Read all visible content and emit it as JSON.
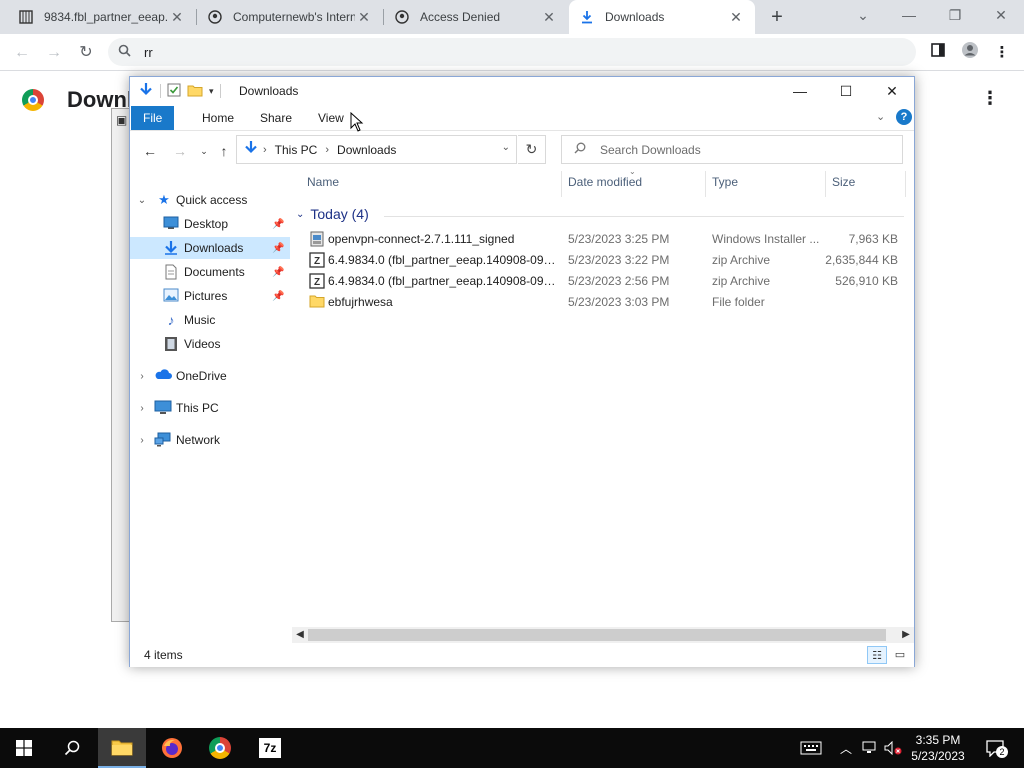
{
  "chrome": {
    "tabs": [
      {
        "title": "9834.fbl_partner_eeap...",
        "icon": "archive-icon"
      },
      {
        "title": "Computernewb's Intern...",
        "icon": "user-icon"
      },
      {
        "title": "Access Denied",
        "icon": "user-icon"
      },
      {
        "title": "Downloads",
        "icon": "download-icon"
      }
    ],
    "omnibox_text": "rr",
    "page_title": "Downlo"
  },
  "explorer": {
    "title": "Downloads",
    "ribbon_tabs": [
      "File",
      "Home",
      "Share",
      "View"
    ],
    "breadcrumb": [
      "This PC",
      "Downloads"
    ],
    "search_placeholder": "Search Downloads",
    "nav": {
      "quick_access": "Quick access",
      "items": [
        "Desktop",
        "Downloads",
        "Documents",
        "Pictures",
        "Music",
        "Videos"
      ],
      "onedrive": "OneDrive",
      "this_pc": "This PC",
      "network": "Network"
    },
    "columns": {
      "name": "Name",
      "date": "Date modified",
      "type": "Type",
      "size": "Size"
    },
    "group": "Today (4)",
    "files": [
      {
        "name": "openvpn-connect-2.7.1.111_signed",
        "date": "5/23/2023 3:25 PM",
        "type": "Windows Installer ...",
        "size": "7,963 KB"
      },
      {
        "name": "6.4.9834.0 (fbl_partner_eeap.140908-0936)...",
        "date": "5/23/2023 3:22 PM",
        "type": "zip Archive",
        "size": "2,635,844 KB"
      },
      {
        "name": "6.4.9834.0 (fbl_partner_eeap.140908-0936)...",
        "date": "5/23/2023 2:56 PM",
        "type": "zip Archive",
        "size": "526,910 KB"
      },
      {
        "name": "ebfujrhwesa",
        "date": "5/23/2023 3:03 PM",
        "type": "File folder",
        "size": ""
      }
    ],
    "status": "4 items"
  },
  "taskbar": {
    "time": "3:35 PM",
    "date": "5/23/2023",
    "notification_count": "2",
    "apps": [
      "start-icon",
      "search-icon",
      "file-explorer-icon",
      "firefox-icon",
      "chrome-icon",
      "7zip-icon"
    ]
  },
  "colors": {
    "accent": "#1979ca",
    "selection": "#cce8ff",
    "taskbar": "#0b0b0b"
  }
}
